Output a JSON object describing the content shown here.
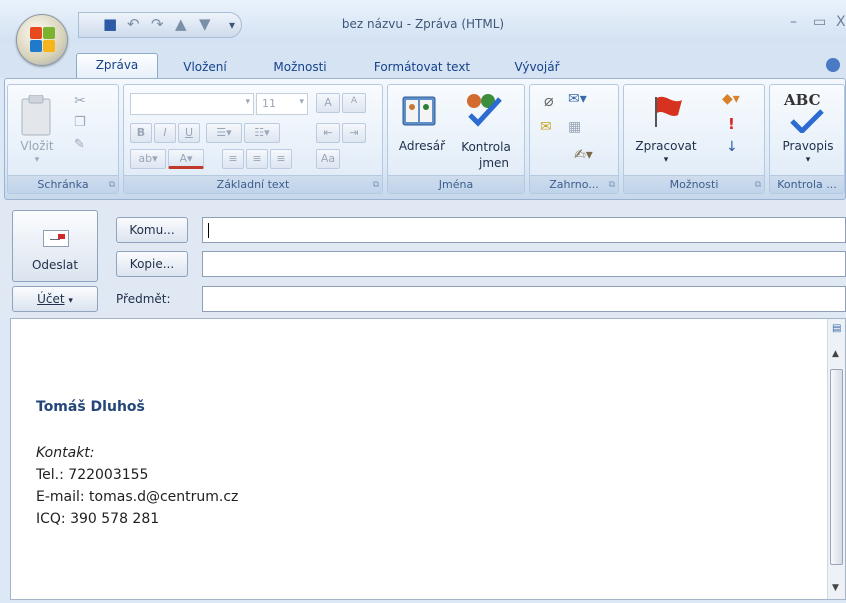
{
  "window": {
    "title": "bez názvu - Zpráva (HTML)",
    "minimize": "–",
    "maximize": "▭",
    "close": "X"
  },
  "quick_access": {
    "dropdown": "▾"
  },
  "tabs": [
    "Zpráva",
    "Vložení",
    "Možnosti",
    "Formátovat text",
    "Vývojář"
  ],
  "ribbon": {
    "clipboard": {
      "label": "Schránka",
      "paste": "Vložit"
    },
    "basic_text": {
      "label": "Základní text",
      "font_size": "11",
      "bold": "B",
      "italic": "I",
      "underline": "U",
      "grow": "A",
      "shrink": "A"
    },
    "names": {
      "label": "Jména",
      "address_book": "Adresář",
      "check_names": [
        "Kontrola",
        "jmen"
      ]
    },
    "include": {
      "label": "Zahrno..."
    },
    "options": {
      "label": "Možnosti",
      "follow_up": "Zpracovat"
    },
    "proofing": {
      "label": "Kontrola ...",
      "spelling": "Pravopis",
      "abc": "ABC"
    }
  },
  "header": {
    "send": "Odeslat",
    "to": "Komu...",
    "cc": "Kopie...",
    "account": "Účet",
    "subject_label": "Předmět:",
    "to_value": "",
    "cc_value": "",
    "subject_value": ""
  },
  "body": {
    "name": "Tomáš Dluhoš",
    "contact_label": "Kontakt:",
    "phone": "Tel.: 722003155",
    "email": "E-mail: tomas.d@centrum.cz",
    "icq": "ICQ: 390 578 281"
  },
  "colors": {
    "accent": "#15428b",
    "signature_name": "#24467a",
    "ribbon_bg": "#dfeaf6"
  }
}
